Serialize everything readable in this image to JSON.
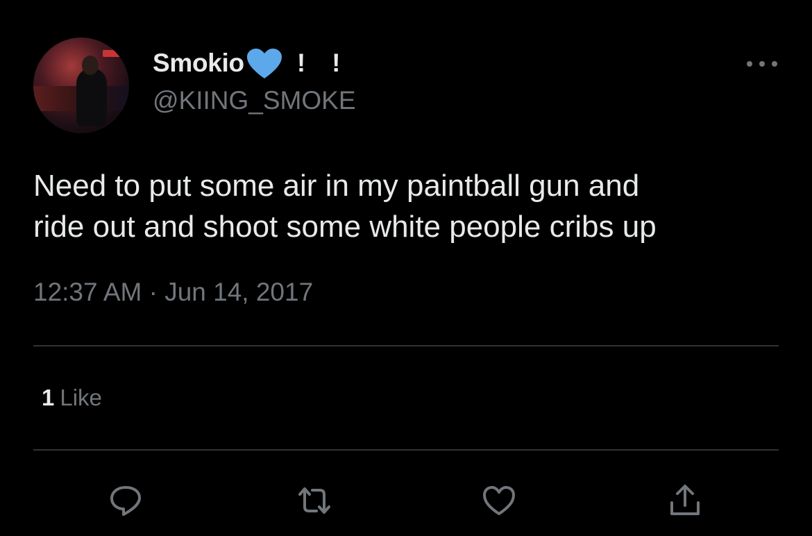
{
  "author": {
    "display_name": "Smokio",
    "verified_badge_icon": "blue-heart-icon",
    "exclamations": [
      "!",
      "!"
    ],
    "handle": "@KIING_SMOKE"
  },
  "menu_icon": "more-horizontal-icon",
  "tweet": {
    "text": "Need to put some air in my paintball gun and\nride out and shoot some white people cribs up",
    "timestamp": "12:37 AM · Jun 14, 2017"
  },
  "stats": {
    "like_count": "1",
    "like_label": "Like"
  },
  "actions": [
    {
      "name": "reply",
      "icon": "reply-icon"
    },
    {
      "name": "retweet",
      "icon": "retweet-icon"
    },
    {
      "name": "like",
      "icon": "heart-outline-icon"
    },
    {
      "name": "share",
      "icon": "share-icon"
    }
  ],
  "colors": {
    "background": "#000000",
    "primary_text": "#e7e9ea",
    "secondary_text": "#71767b",
    "divider": "#2f3336",
    "heart_badge": "#5ca8ea"
  }
}
